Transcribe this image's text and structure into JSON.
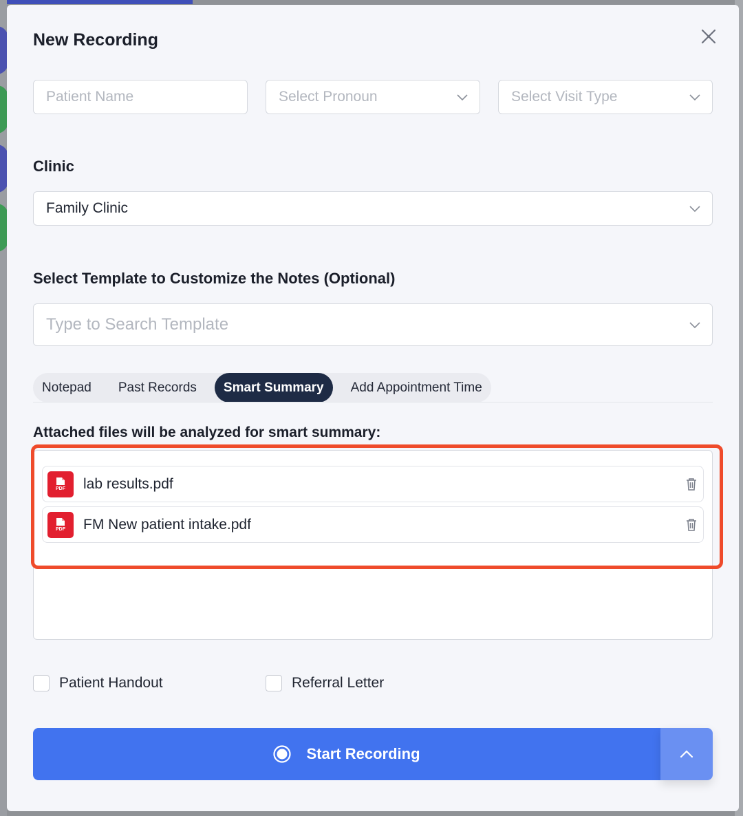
{
  "modal": {
    "title": "New Recording",
    "close_icon": "close-icon"
  },
  "fields": {
    "patient_name_placeholder": "Patient Name",
    "pronoun_placeholder": "Select Pronoun",
    "visit_type_placeholder": "Select Visit Type"
  },
  "clinic": {
    "label": "Clinic",
    "selected": "Family Clinic"
  },
  "template": {
    "label": "Select Template to Customize the Notes (Optional)",
    "placeholder": "Type to Search Template"
  },
  "tabs": [
    {
      "label": "Notepad",
      "active": false
    },
    {
      "label": "Past Records",
      "active": false
    },
    {
      "label": "Smart Summary",
      "active": true
    },
    {
      "label": "Add Appointment Time",
      "active": false
    }
  ],
  "smart_summary": {
    "note": "Attached files will be analyzed for smart summary:",
    "files": [
      {
        "name": "lab results.pdf",
        "icon": "pdf-file-icon",
        "badge": "PDF"
      },
      {
        "name": "FM New patient intake.pdf",
        "icon": "pdf-file-icon",
        "badge": "PDF"
      }
    ]
  },
  "options": {
    "patient_handout": {
      "label": "Patient Handout",
      "checked": false
    },
    "referral_letter": {
      "label": "Referral Letter",
      "checked": false
    }
  },
  "actions": {
    "start_label": "Start Recording",
    "start_icon": "record-icon",
    "toggle_icon": "chevron-up-icon"
  },
  "colors": {
    "primary": "#4173ef",
    "active_tab": "#1e2b45",
    "pdf_red": "#e21f2f",
    "highlight": "#ef4b2b"
  }
}
